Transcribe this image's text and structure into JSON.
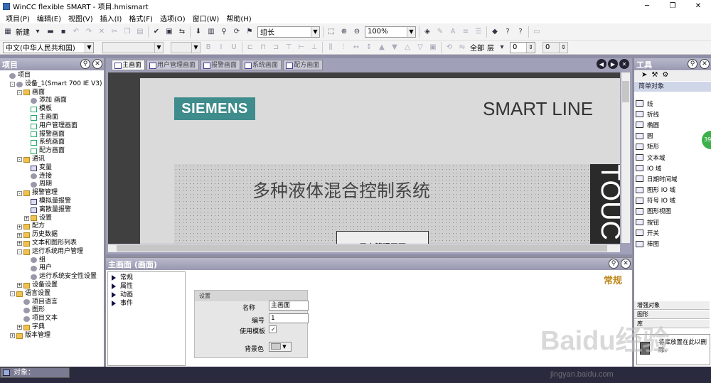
{
  "window": {
    "title": "WinCC flexible SMART - 项目.hmismart",
    "minimize": "─",
    "restore": "❐",
    "close": "✕"
  },
  "menu": [
    "项目(P)",
    "编辑(E)",
    "视图(V)",
    "插入(I)",
    "格式(F)",
    "选项(O)",
    "窗口(W)",
    "帮助(H)"
  ],
  "toolbar": {
    "new_label": "新建",
    "group_combo": "组长",
    "zoom_combo": "100%",
    "language_combo": "中文(中华人民共和国)",
    "all_label": "全部",
    "layer_label": "层",
    "layer_value": "0",
    "spin_value": "0"
  },
  "project_panel": {
    "title": "项目",
    "tree": [
      {
        "indent": 0,
        "label": "项目",
        "icon": "project-icon",
        "exp": ""
      },
      {
        "indent": 1,
        "label": "设备_1(Smart 700 IE V3)",
        "icon": "device-icon",
        "exp": "-"
      },
      {
        "indent": 2,
        "label": "画面",
        "icon": "folder-icon",
        "exp": "-"
      },
      {
        "indent": 3,
        "label": "添加 画面",
        "icon": "add-screen-icon",
        "exp": ""
      },
      {
        "indent": 3,
        "label": "模板",
        "icon": "template-icon",
        "exp": ""
      },
      {
        "indent": 3,
        "label": "主画面",
        "icon": "screen-icon",
        "exp": ""
      },
      {
        "indent": 3,
        "label": "用户管理画面",
        "icon": "screen-icon",
        "exp": ""
      },
      {
        "indent": 3,
        "label": "报警画面",
        "icon": "screen-icon",
        "exp": ""
      },
      {
        "indent": 3,
        "label": "系统画面",
        "icon": "screen-icon",
        "exp": ""
      },
      {
        "indent": 3,
        "label": "配方画面",
        "icon": "screen-icon",
        "exp": ""
      },
      {
        "indent": 2,
        "label": "通讯",
        "icon": "folder-icon",
        "exp": "-"
      },
      {
        "indent": 3,
        "label": "变量",
        "icon": "tags-icon",
        "exp": ""
      },
      {
        "indent": 3,
        "label": "连接",
        "icon": "connection-icon",
        "exp": ""
      },
      {
        "indent": 3,
        "label": "周期",
        "icon": "cycle-icon",
        "exp": ""
      },
      {
        "indent": 2,
        "label": "报警管理",
        "icon": "folder-icon",
        "exp": "-"
      },
      {
        "indent": 3,
        "label": "模拟量报警",
        "icon": "alarm-icon",
        "exp": ""
      },
      {
        "indent": 3,
        "label": "离散量报警",
        "icon": "alarm-icon",
        "exp": ""
      },
      {
        "indent": 3,
        "label": "设置",
        "icon": "folder-icon",
        "exp": "+"
      },
      {
        "indent": 2,
        "label": "配方",
        "icon": "folder-icon",
        "exp": "+"
      },
      {
        "indent": 2,
        "label": "历史数据",
        "icon": "folder-icon",
        "exp": "+"
      },
      {
        "indent": 2,
        "label": "文本和图形列表",
        "icon": "folder-icon",
        "exp": "+"
      },
      {
        "indent": 2,
        "label": "运行系统用户管理",
        "icon": "folder-icon",
        "exp": "-"
      },
      {
        "indent": 3,
        "label": "组",
        "icon": "group-icon",
        "exp": ""
      },
      {
        "indent": 3,
        "label": "用户",
        "icon": "user-icon",
        "exp": ""
      },
      {
        "indent": 3,
        "label": "运行系统安全性设置",
        "icon": "security-icon",
        "exp": ""
      },
      {
        "indent": 2,
        "label": "设备设置",
        "icon": "folder-icon",
        "exp": "+"
      },
      {
        "indent": 1,
        "label": "语言设置",
        "icon": "folder-icon",
        "exp": "-"
      },
      {
        "indent": 2,
        "label": "项目语言",
        "icon": "language-icon",
        "exp": ""
      },
      {
        "indent": 2,
        "label": "图形",
        "icon": "graphics-icon",
        "exp": ""
      },
      {
        "indent": 2,
        "label": "项目文本",
        "icon": "text-icon",
        "exp": ""
      },
      {
        "indent": 2,
        "label": "字典",
        "icon": "folder-icon",
        "exp": "+"
      },
      {
        "indent": 1,
        "label": "版本管理",
        "icon": "folder-icon",
        "exp": "+"
      }
    ]
  },
  "editor": {
    "tabs": [
      "主画面",
      "用户管理画面",
      "报警画面",
      "系统画面",
      "配方画面"
    ],
    "screen": {
      "brand": "SIEMENS",
      "product": "SMART LINE",
      "title": "多种液体混合控制系统",
      "user_button": "用户管理画面",
      "side_text": "TOUC"
    }
  },
  "properties": {
    "title": "主画面 (画面)",
    "nav": [
      "常规",
      "属性",
      "动画",
      "事件"
    ],
    "section": "常规",
    "group": "设置",
    "name_label": "名称",
    "name_value": "主画面",
    "number_label": "编号",
    "number_value": "1",
    "template_label": "使用模板",
    "bg_label": "背景色"
  },
  "tools": {
    "title": "工具",
    "category": "简单对象",
    "items": [
      "线",
      "折线",
      "椭圆",
      "圆",
      "矩形",
      "文本域",
      "IO 域",
      "日期时间域",
      "图形 IO 域",
      "符号 IO 域",
      "图形视图",
      "按钮",
      "开关",
      "棒图"
    ],
    "sections": [
      "增强对象",
      "图形",
      "库"
    ],
    "tooltip": "将库放置在此以删除。"
  },
  "status": {
    "object_label": "对象："
  },
  "overlay": {
    "badge": "39",
    "watermark": "Baidu经验",
    "watermark_url": "jingyan.baidu.com"
  }
}
